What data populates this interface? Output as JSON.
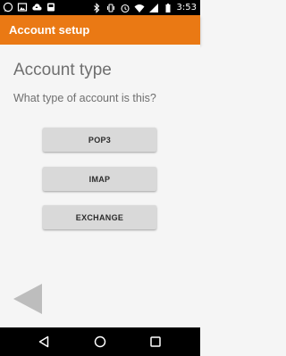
{
  "status_bar": {
    "time": "3:53",
    "icons": [
      "whatsapp-icon",
      "image-icon",
      "cloud-upload-icon",
      "media-icon",
      "bluetooth-icon",
      "vibrate-icon",
      "alarm-icon",
      "wifi-icon",
      "signal-icon",
      "battery-icon"
    ]
  },
  "app_bar": {
    "title": "Account setup",
    "color": "#ea7914"
  },
  "main": {
    "heading": "Account type",
    "question": "What type of account is this?",
    "options": [
      {
        "label": "POP3"
      },
      {
        "label": "IMAP"
      },
      {
        "label": "EXCHANGE"
      }
    ],
    "back_icon": "triangle-left-icon"
  },
  "nav_bar": {
    "icons": [
      "nav-back-icon",
      "nav-home-icon",
      "nav-recents-icon"
    ]
  }
}
